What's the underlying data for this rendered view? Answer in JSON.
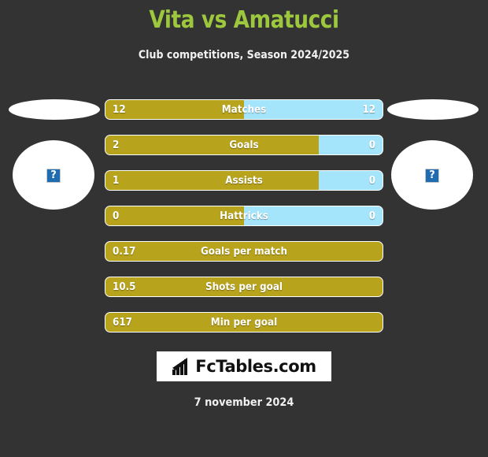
{
  "header": {
    "title": "Vita vs Amatucci",
    "subtitle": "Club competitions, Season 2024/2025",
    "title_color": "#9dc83d"
  },
  "players": {
    "left": {
      "name": "",
      "photo_icon": "broken-image-icon",
      "placeholder_glyph": "?"
    },
    "right": {
      "name": "",
      "photo_icon": "broken-image-icon",
      "placeholder_glyph": "?"
    }
  },
  "colors": {
    "background": "#333333",
    "home_bar": "#b8a31c",
    "away_bar": "#a5e5fb",
    "text": "#ffffff"
  },
  "chart_data": {
    "type": "bar",
    "title": "Vita vs Amatucci",
    "subtitle": "Club competitions, Season 2024/2025",
    "orientation": "horizontal-diverging",
    "categories": [
      "Matches",
      "Goals",
      "Assists",
      "Hattricks",
      "Goals per match",
      "Shots per goal",
      "Min per goal"
    ],
    "series": [
      {
        "name": "Vita",
        "color": "#b8a31c",
        "values": [
          "12",
          "2",
          "1",
          "0",
          "0.17",
          "10.5",
          "617"
        ]
      },
      {
        "name": "Amatucci",
        "color": "#a5e5fb",
        "values": [
          "12",
          "0",
          "0",
          "0",
          null,
          null,
          null
        ]
      }
    ],
    "fill_percent": [
      50,
      77,
      77,
      50,
      100,
      100,
      100
    ],
    "legend": "none",
    "grid": false
  },
  "rows": [
    {
      "label": "Matches",
      "left": "12",
      "right": "12",
      "fill": 50,
      "split": true
    },
    {
      "label": "Goals",
      "left": "2",
      "right": "0",
      "fill": 77,
      "split": true
    },
    {
      "label": "Assists",
      "left": "1",
      "right": "0",
      "fill": 77,
      "split": true
    },
    {
      "label": "Hattricks",
      "left": "0",
      "right": "0",
      "fill": 50,
      "split": true
    },
    {
      "label": "Goals per match",
      "left": "0.17",
      "right": "",
      "fill": 100,
      "split": false
    },
    {
      "label": "Shots per goal",
      "left": "10.5",
      "right": "",
      "fill": 100,
      "split": false
    },
    {
      "label": "Min per goal",
      "left": "617",
      "right": "",
      "fill": 100,
      "split": false
    }
  ],
  "footer": {
    "logo_text": "FcTables.com",
    "logo_icon": "bar-chart-icon",
    "date": "7 november 2024"
  }
}
